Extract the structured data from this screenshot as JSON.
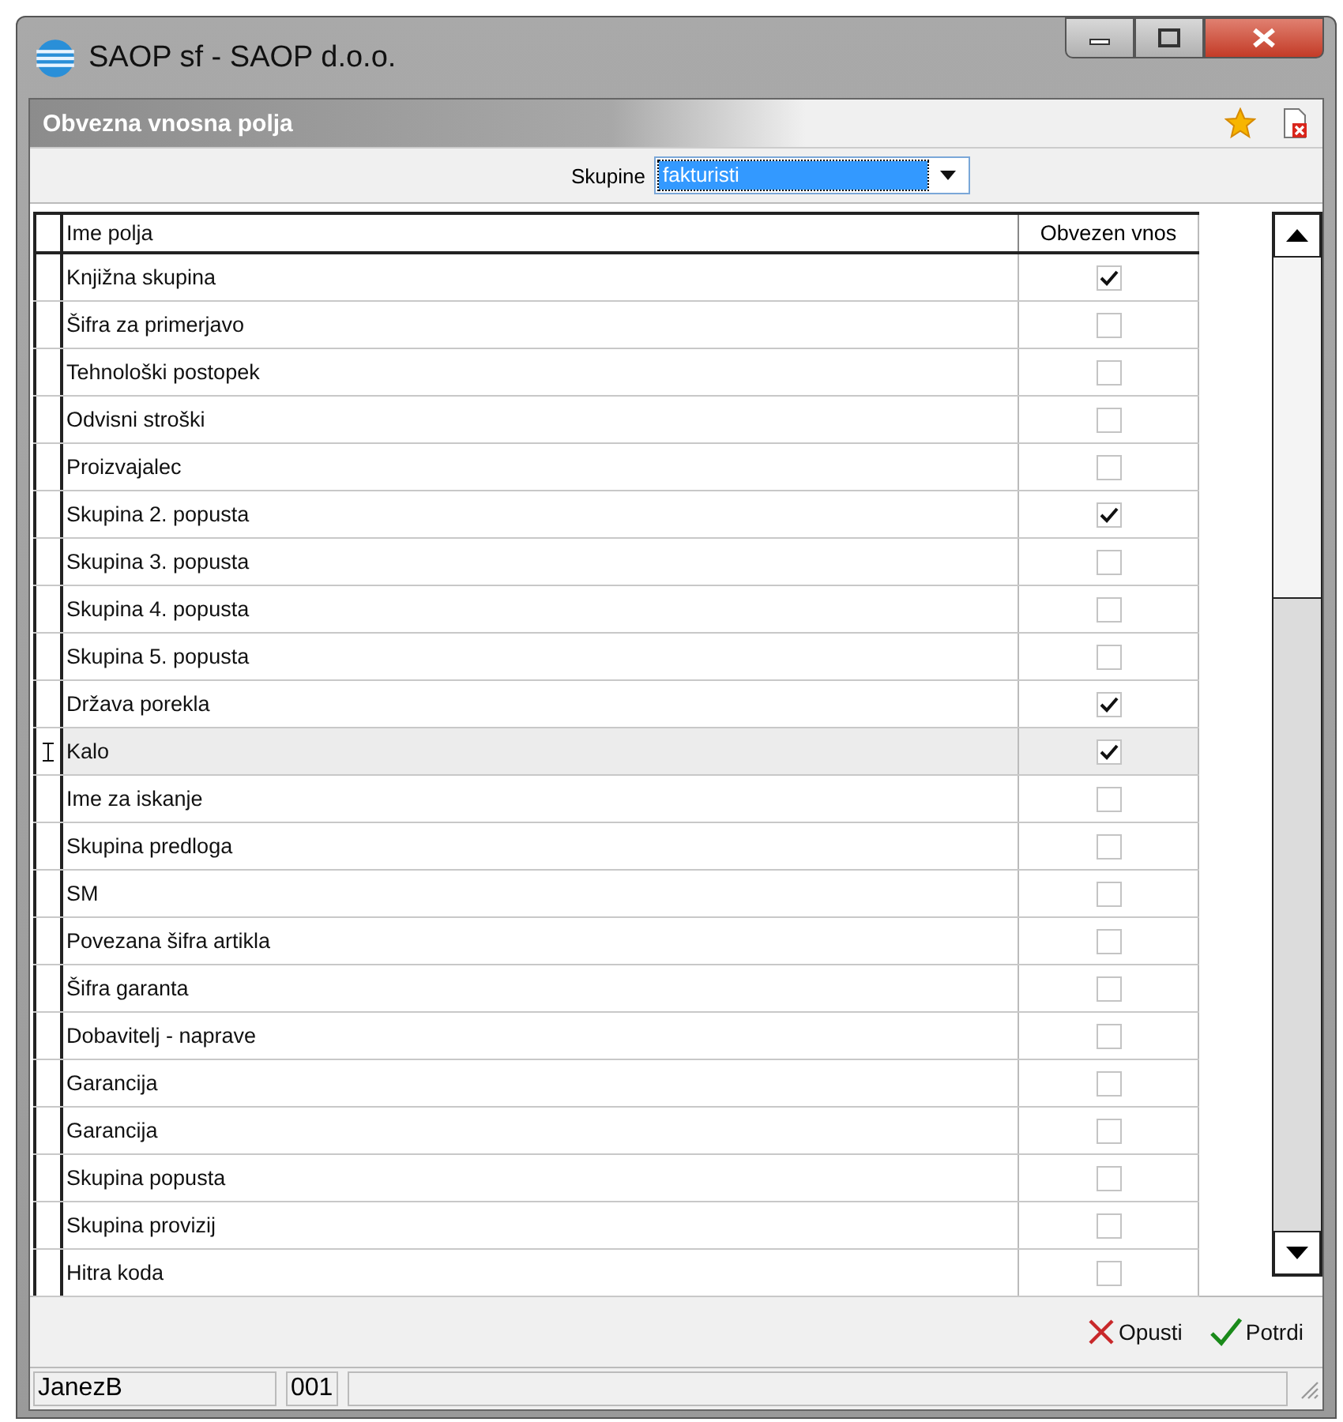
{
  "window": {
    "title": "SAOP sf - SAOP d.o.o."
  },
  "panel": {
    "title": "Obvezna vnosna polja"
  },
  "filter": {
    "label": "Skupine",
    "value": "fakturisti"
  },
  "table": {
    "columns": [
      "Ime polja",
      "Obvezen vnos"
    ],
    "rows": [
      {
        "name": "Knjižna skupina",
        "checked": true,
        "selected": false
      },
      {
        "name": "Šifra za primerjavo",
        "checked": false,
        "selected": false
      },
      {
        "name": "Tehnološki postopek",
        "checked": false,
        "selected": false
      },
      {
        "name": "Odvisni stroški",
        "checked": false,
        "selected": false
      },
      {
        "name": "Proizvajalec",
        "checked": false,
        "selected": false
      },
      {
        "name": "Skupina 2. popusta",
        "checked": true,
        "selected": false
      },
      {
        "name": "Skupina 3. popusta",
        "checked": false,
        "selected": false
      },
      {
        "name": "Skupina 4. popusta",
        "checked": false,
        "selected": false
      },
      {
        "name": "Skupina 5. popusta",
        "checked": false,
        "selected": false
      },
      {
        "name": "Država porekla",
        "checked": true,
        "selected": false
      },
      {
        "name": "Kalo",
        "checked": true,
        "selected": true
      },
      {
        "name": "Ime za iskanje",
        "checked": false,
        "selected": false
      },
      {
        "name": "Skupina predloga",
        "checked": false,
        "selected": false
      },
      {
        "name": "SM",
        "checked": false,
        "selected": false
      },
      {
        "name": "Povezana šifra artikla",
        "checked": false,
        "selected": false
      },
      {
        "name": "Šifra garanta",
        "checked": false,
        "selected": false
      },
      {
        "name": "Dobavitelj - naprave",
        "checked": false,
        "selected": false
      },
      {
        "name": "Garancija",
        "checked": false,
        "selected": false
      },
      {
        "name": "Garancija",
        "checked": false,
        "selected": false
      },
      {
        "name": "Skupina popusta",
        "checked": false,
        "selected": false
      },
      {
        "name": "Skupina provizij",
        "checked": false,
        "selected": false
      },
      {
        "name": "Hitra koda",
        "checked": false,
        "selected": false
      }
    ]
  },
  "buttons": [
    {
      "kind": "cancel",
      "label": "Opusti"
    },
    {
      "kind": "confirm",
      "label": "Potrdi"
    }
  ],
  "status_bar": [
    "JanezB",
    "001"
  ]
}
